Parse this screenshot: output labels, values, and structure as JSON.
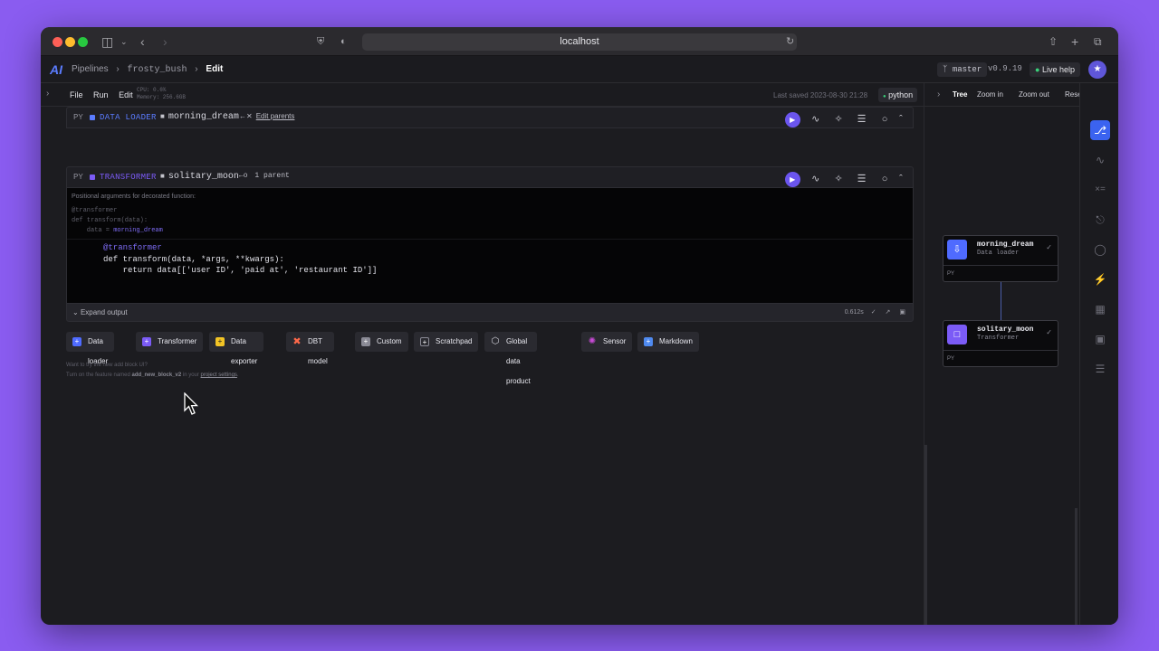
{
  "browser": {
    "url": "localhost"
  },
  "header": {
    "logo": "AI",
    "breadcrumbs": [
      "Pipelines",
      "frosty_bush",
      "Edit"
    ],
    "branch": "master",
    "version": "v0.9.19",
    "live_help": "Live help"
  },
  "toolbar": {
    "menu": [
      "File",
      "Run",
      "Edit"
    ],
    "usage_cpu": "CPU: 0.6%",
    "usage_memory": "Memory: 256.6GB",
    "last_saved": "Last saved 2023-08-30 21:28",
    "kernel": "python"
  },
  "blocks": [
    {
      "lang": "PY",
      "type": "DATA LOADER",
      "name": "morning_dream",
      "link_icon": "←✕",
      "link_text": "Edit parents"
    },
    {
      "lang": "PY",
      "type": "TRANSFORMER",
      "name": "solitary_moon",
      "link_icon": "←o",
      "link_text": "1 parent"
    }
  ],
  "code": {
    "hint": "Positional arguments for decorated function:",
    "ghost_line1": "@transformer",
    "ghost_line2": "def transform(data):",
    "ghost_line3_prefix": "    data = ",
    "ghost_line3_var": "morning_dream",
    "line1": "@transformer",
    "line2": "def transform(data, *args, **kwargs):",
    "line3": "    return data[['user ID', 'paid at', 'restaurant ID']]"
  },
  "output": {
    "expand_label": "Expand output",
    "exec_time": "0.612s"
  },
  "add_blocks": [
    {
      "label": "Data loader",
      "icon": "plus-icon",
      "color": "#4f6bff"
    },
    {
      "label": "Transformer",
      "icon": "plus-icon",
      "color": "#7b5bf6"
    },
    {
      "label": "Data exporter",
      "icon": "plus-icon",
      "color": "#f2c425"
    },
    {
      "label": "DBT model",
      "icon": "dbt-icon",
      "color": "#ff694a"
    },
    {
      "label": "Custom",
      "icon": "plus-icon",
      "color": "#8a8a95"
    },
    {
      "label": "Scratchpad",
      "icon": "plus-icon",
      "color": "#3a3a42"
    },
    {
      "label": "Global data product",
      "icon": "cube-icon",
      "color": "#2a2a30"
    },
    {
      "label": "Sensor",
      "icon": "sensor-icon",
      "color": "#c84bd6"
    },
    {
      "label": "Markdown",
      "icon": "plus-icon",
      "color": "#4f8af0"
    }
  ],
  "tip": {
    "line1": "Want to try the new add block UI?",
    "line2_prefix": "Turn on the feature named ",
    "feature": "add_new_block_v2",
    "line2_mid": " in your ",
    "settings_link": "project settings",
    "line2_suffix": "."
  },
  "tree": {
    "tabs": [
      "Tree",
      "Zoom in",
      "Zoom out",
      "Rese"
    ],
    "nodes": [
      {
        "name": "morning_dream",
        "type": "Data loader",
        "lang": "PY",
        "color": "#4f6bff"
      },
      {
        "name": "solitary_moon",
        "type": "Transformer",
        "lang": "PY",
        "color": "#7b5bf6"
      }
    ]
  },
  "colors": {
    "accent": "#5b7cff",
    "transformer": "#7b5bf6",
    "background": "#8a5cf0"
  }
}
